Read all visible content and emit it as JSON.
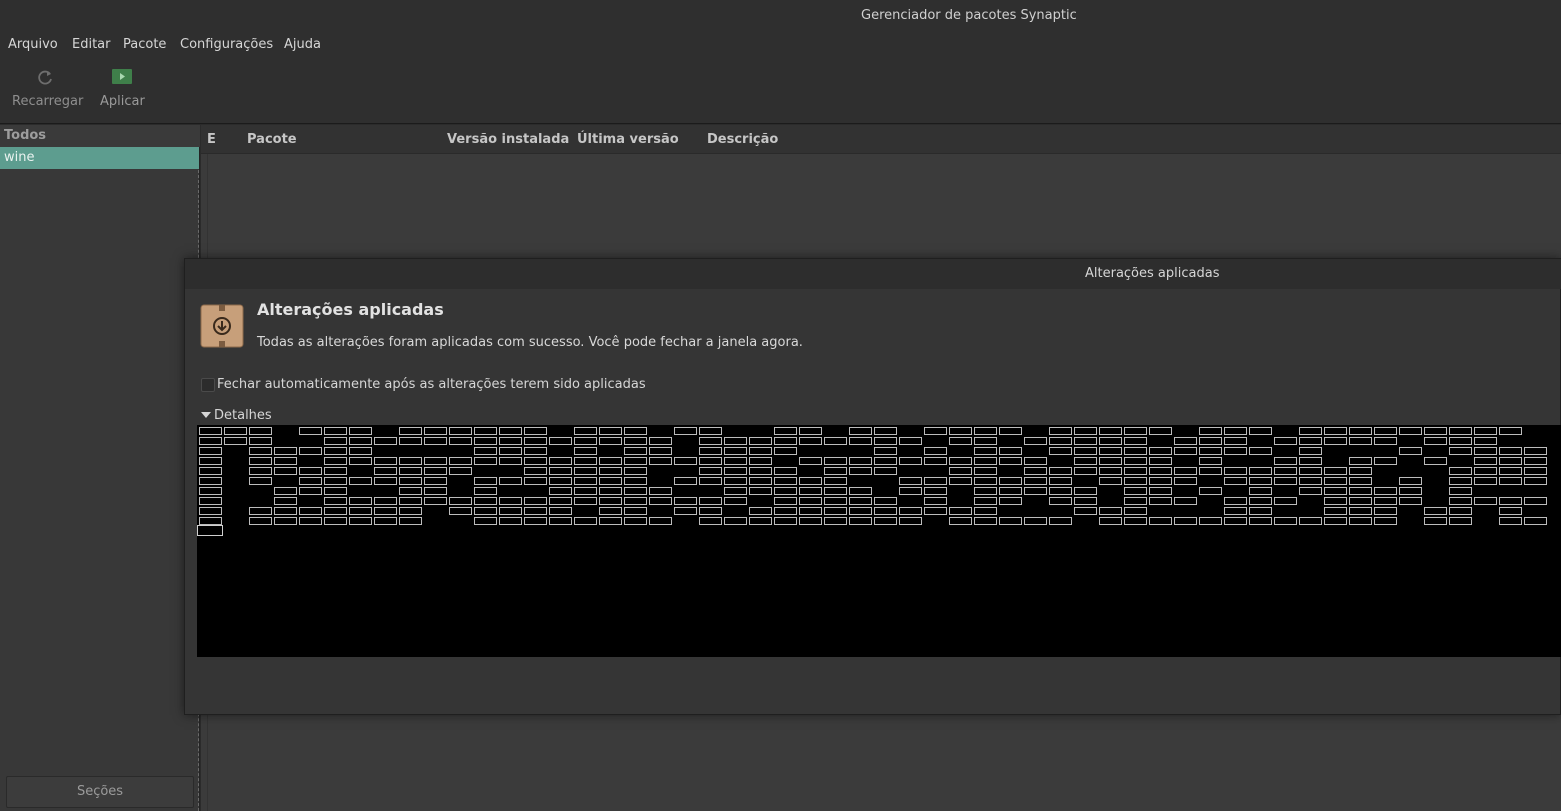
{
  "window": {
    "title": "Gerenciador de pacotes Synaptic"
  },
  "menu": {
    "items": [
      "Arquivo",
      "Editar",
      "Pacote",
      "Configurações",
      "Ajuda"
    ]
  },
  "toolbar": {
    "reload": {
      "label": "Recarregar",
      "icon": "reload-icon"
    },
    "apply": {
      "label": "Aplicar",
      "icon": "apply-icon"
    }
  },
  "sidebar": {
    "header": "Todos",
    "selected": "wine",
    "sections_button": "Seções"
  },
  "table": {
    "columns": [
      "E",
      "Pacote",
      "Versão instalada",
      "Última versão",
      "Descrição"
    ]
  },
  "dialog": {
    "window_title": "Alterações aplicadas",
    "heading": "Alterações aplicadas",
    "message": "Todas as alterações foram aplicadas com sucesso. Você pode fechar a janela agora.",
    "auto_close_label": "Fechar automaticamente após as alterações terem sido aplicadas",
    "auto_close_checked": false,
    "details_label": "Detalhes",
    "details_expanded": true
  },
  "colors": {
    "selection": "#5d9d8f",
    "terminal_bg": "#000000",
    "window_bg": "#2f2f2f"
  }
}
